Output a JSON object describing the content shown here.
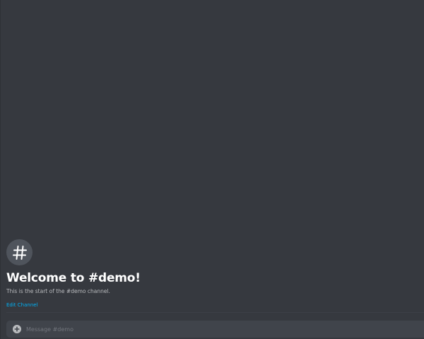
{
  "welcome": {
    "icon": "hash-icon",
    "title": "Welcome to #demo!",
    "subtitle": "This is the start of the #demo channel.",
    "edit_link": "Edit Channel"
  },
  "composer": {
    "attach_icon": "plus-circle-icon",
    "placeholder": "Message #demo"
  },
  "colors": {
    "background": "#36393f",
    "title": "#ffffff",
    "subtitle": "#b9bbbe",
    "link": "#00b0f4",
    "composer_bg": "#40444b",
    "placeholder": "#72767d"
  }
}
